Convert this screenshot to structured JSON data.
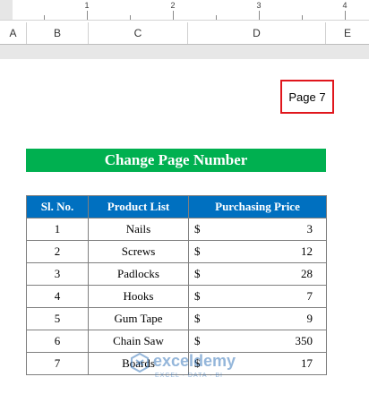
{
  "ruler": {
    "numbers": [
      "1",
      "2",
      "3",
      "4"
    ]
  },
  "columns": [
    "A",
    "B",
    "C",
    "D",
    "E"
  ],
  "header_footer": {
    "page_label": "Page 7"
  },
  "sheet": {
    "title": "Change Page Number",
    "table": {
      "headers": [
        "Sl. No.",
        "Product List",
        "Purchasing Price"
      ],
      "rows": [
        {
          "no": "1",
          "product": "Nails",
          "currency": "$",
          "price": "3"
        },
        {
          "no": "2",
          "product": "Screws",
          "currency": "$",
          "price": "12"
        },
        {
          "no": "3",
          "product": "Padlocks",
          "currency": "$",
          "price": "28"
        },
        {
          "no": "4",
          "product": "Hooks",
          "currency": "$",
          "price": "7"
        },
        {
          "no": "5",
          "product": "Gum Tape",
          "currency": "$",
          "price": "9"
        },
        {
          "no": "6",
          "product": "Chain Saw",
          "currency": "$",
          "price": "350"
        },
        {
          "no": "7",
          "product": "Boards",
          "currency": "$",
          "price": "17"
        }
      ]
    }
  },
  "watermark": {
    "name": "exceldemy",
    "tagline": "EXCEL · DATA · BI"
  },
  "colors": {
    "title_bg": "#00b050",
    "header_bg": "#0070c0",
    "page_box_border": "#e0161c"
  }
}
